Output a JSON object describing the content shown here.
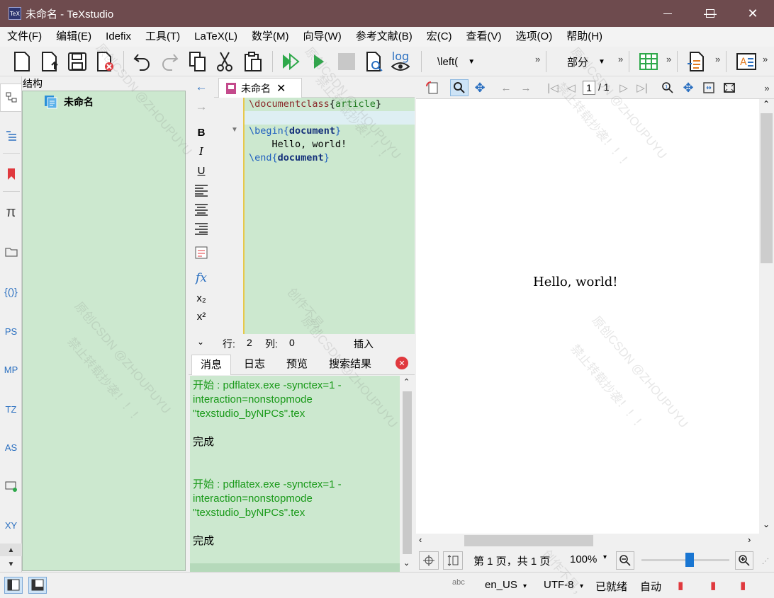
{
  "window": {
    "title": "未命名 - TeXstudio",
    "app_icon_text": "TeX",
    "minimize": "—",
    "maximize": "☐",
    "close": "✕"
  },
  "menu": [
    "文件(F)",
    "编辑(E)",
    "Idefix",
    "工具(T)",
    "LaTeX(L)",
    "数学(M)",
    "向导(W)",
    "参考文献(B)",
    "宏(C)",
    "查看(V)",
    "选项(O)",
    "帮助(H)"
  ],
  "toolbar": {
    "log_label": "log",
    "left_combo": "\\left(",
    "section_combo": "部分",
    "more": "»"
  },
  "structure": {
    "header": "结构",
    "root": "未命名"
  },
  "sidebar": {
    "labels": [
      "PS",
      "MP",
      "TZ",
      "AS",
      "XY"
    ]
  },
  "format": {
    "bold": "B",
    "italic": "I",
    "underline": "U",
    "fx": "fx",
    "subscript": "x₂",
    "superscript": "x²"
  },
  "editor": {
    "tab_title": "未命名",
    "lines": [
      {
        "cmd": "\\documentclass",
        "open": "{",
        "arg": "article",
        "close": "}"
      },
      {
        "text": ""
      },
      {
        "cmd": "\\begin",
        "open": "{",
        "arg": "document",
        "close": "}"
      },
      {
        "text": "    Hello, world!"
      },
      {
        "cmd": "\\end",
        "open": "{",
        "arg": "document",
        "close": "}"
      }
    ],
    "status": {
      "row_label": "行:",
      "row": "2",
      "col_label": "列:",
      "col": "0",
      "mode": "插入"
    }
  },
  "messages": {
    "tabs": [
      "消息",
      "日志",
      "预览",
      "搜索结果"
    ],
    "block1": [
      "开始 : pdflatex.exe -synctex=1 -",
      "interaction=nonstopmode",
      "\"texstudio_byNPCs\".tex"
    ],
    "done1": "完成",
    "block2": [
      "开始 : pdflatex.exe -synctex=1 -",
      "interaction=nonstopmode",
      "\"texstudio_byNPCs\".tex"
    ],
    "done2": "完成"
  },
  "pdf": {
    "page_current": "1",
    "page_total": "/ 1",
    "page_text": "Hello, world!",
    "status_page": "第 1 页，共 1 页",
    "zoom": "100%",
    "zoom_level": 0.55
  },
  "statusbar": {
    "language": "en_US",
    "encoding": "UTF-8",
    "ready": "已就绪",
    "auto": "自动"
  },
  "watermark": {
    "line1": "创作不易，",
    "line2": "原创CSDN @ZHOUPUYU",
    "line3": "禁止转载抄袭！！！",
    "line4": "违者必究！！"
  },
  "colors": {
    "titlebar": "#6e4b4e",
    "panel_green": "#cce8cf",
    "run_green": "#2ea84a",
    "accent_blue": "#2a6fc0"
  }
}
